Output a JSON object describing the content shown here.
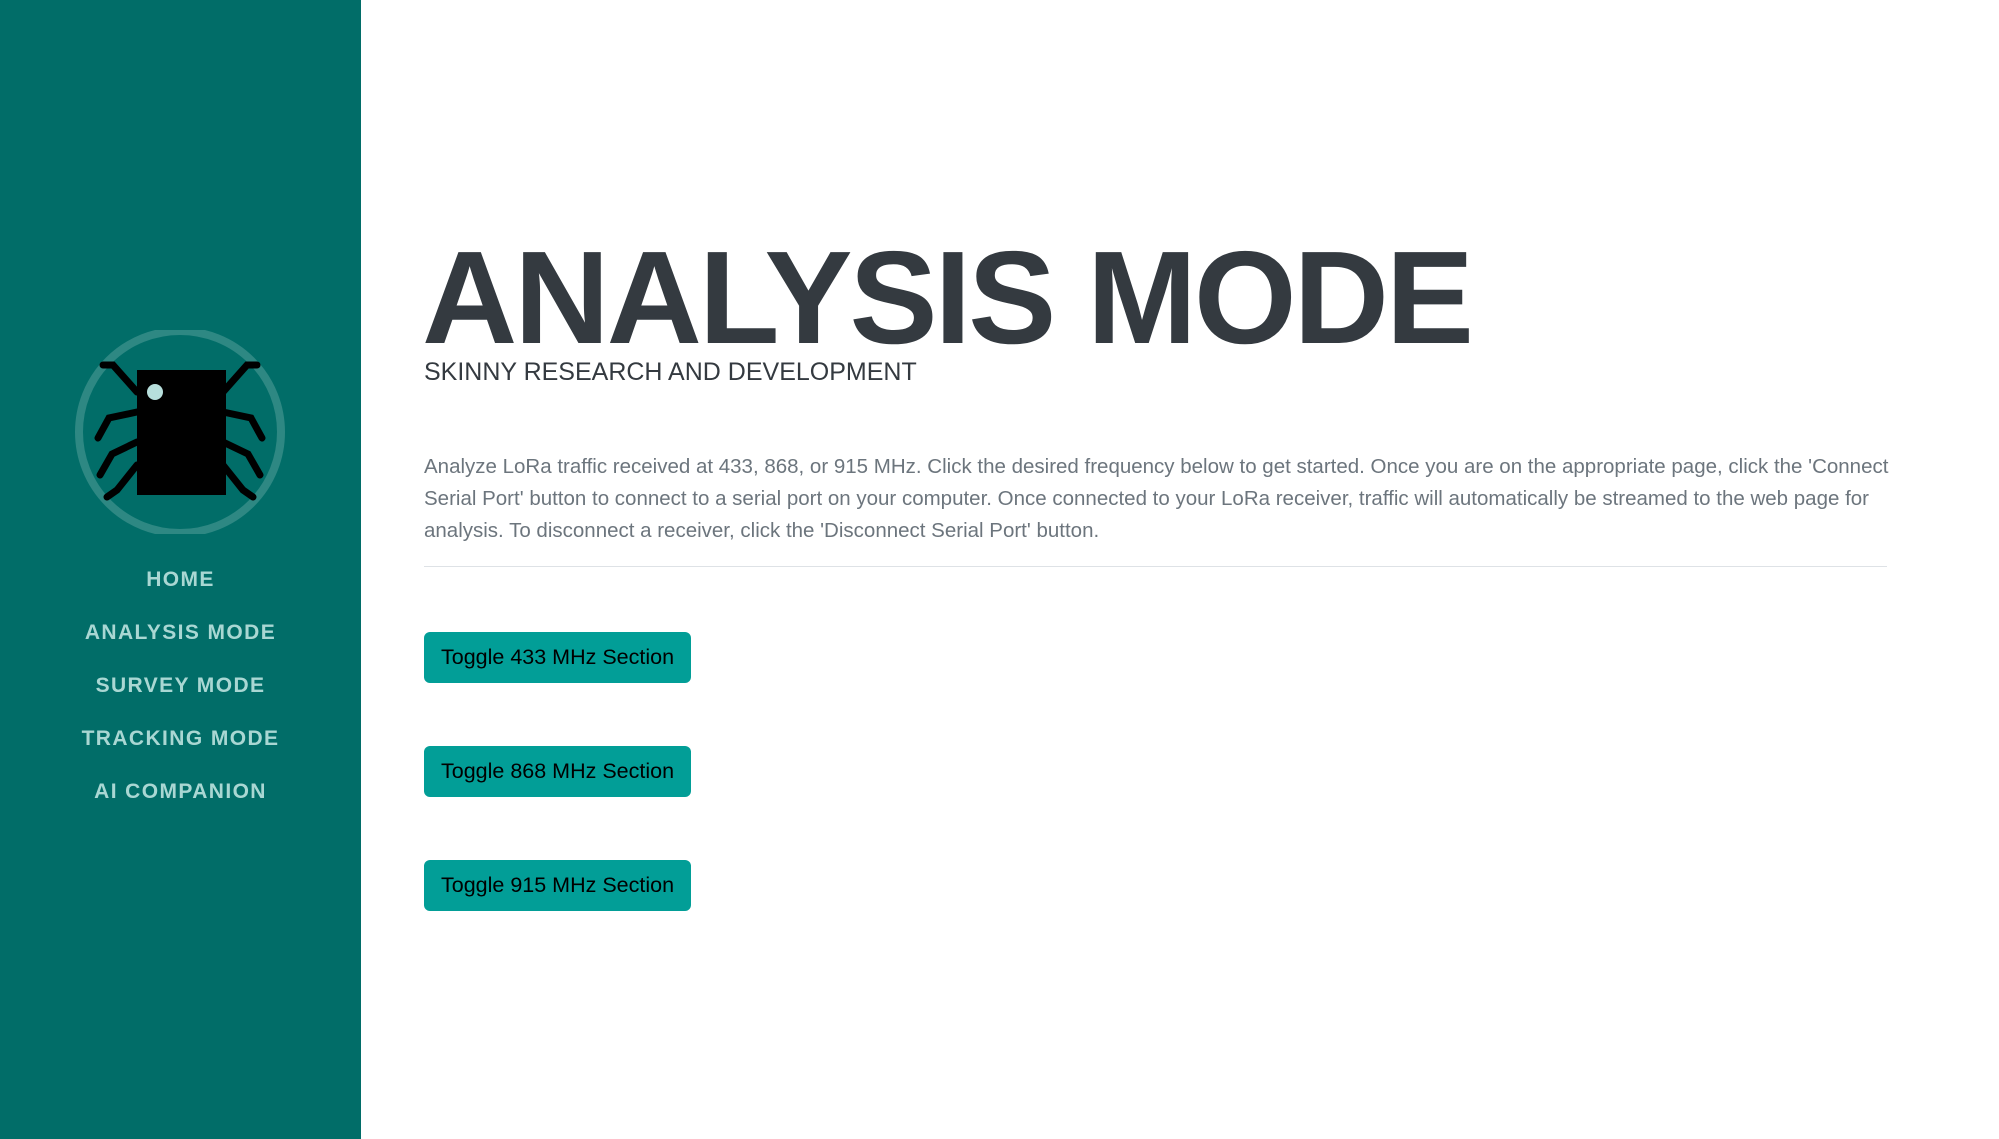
{
  "sidebar": {
    "logo_icon": "circuit-chip-bug-logo-icon",
    "background_color": "#016d68",
    "nav_color": "#a9d7d3",
    "items": [
      {
        "label": "HOME"
      },
      {
        "label": "ANALYSIS MODE"
      },
      {
        "label": "SURVEY MODE"
      },
      {
        "label": "TRACKING MODE"
      },
      {
        "label": "AI COMPANION"
      }
    ]
  },
  "main": {
    "title": "ANALYSIS MODE",
    "subtitle": "SKINNY RESEARCH AND DEVELOPMENT",
    "description": "Analyze LoRa traffic received at 433, 868, or 915 MHz. Click the desired frequency below to get started. Once you are on the appropriate page, click the 'Connect Serial Port' button to connect to a serial port on your computer. Once connected to your LoRa receiver, traffic will automatically be streamed to the web page for analysis. To disconnect a receiver, click the 'Disconnect Serial Port' button.",
    "buttons": [
      {
        "label": "Toggle 433 MHz Section"
      },
      {
        "label": "Toggle 868 MHz Section"
      },
      {
        "label": "Toggle 915 MHz Section"
      }
    ],
    "button_color": "#029e97",
    "title_color": "#343a40",
    "text_color": "#6c757d"
  }
}
